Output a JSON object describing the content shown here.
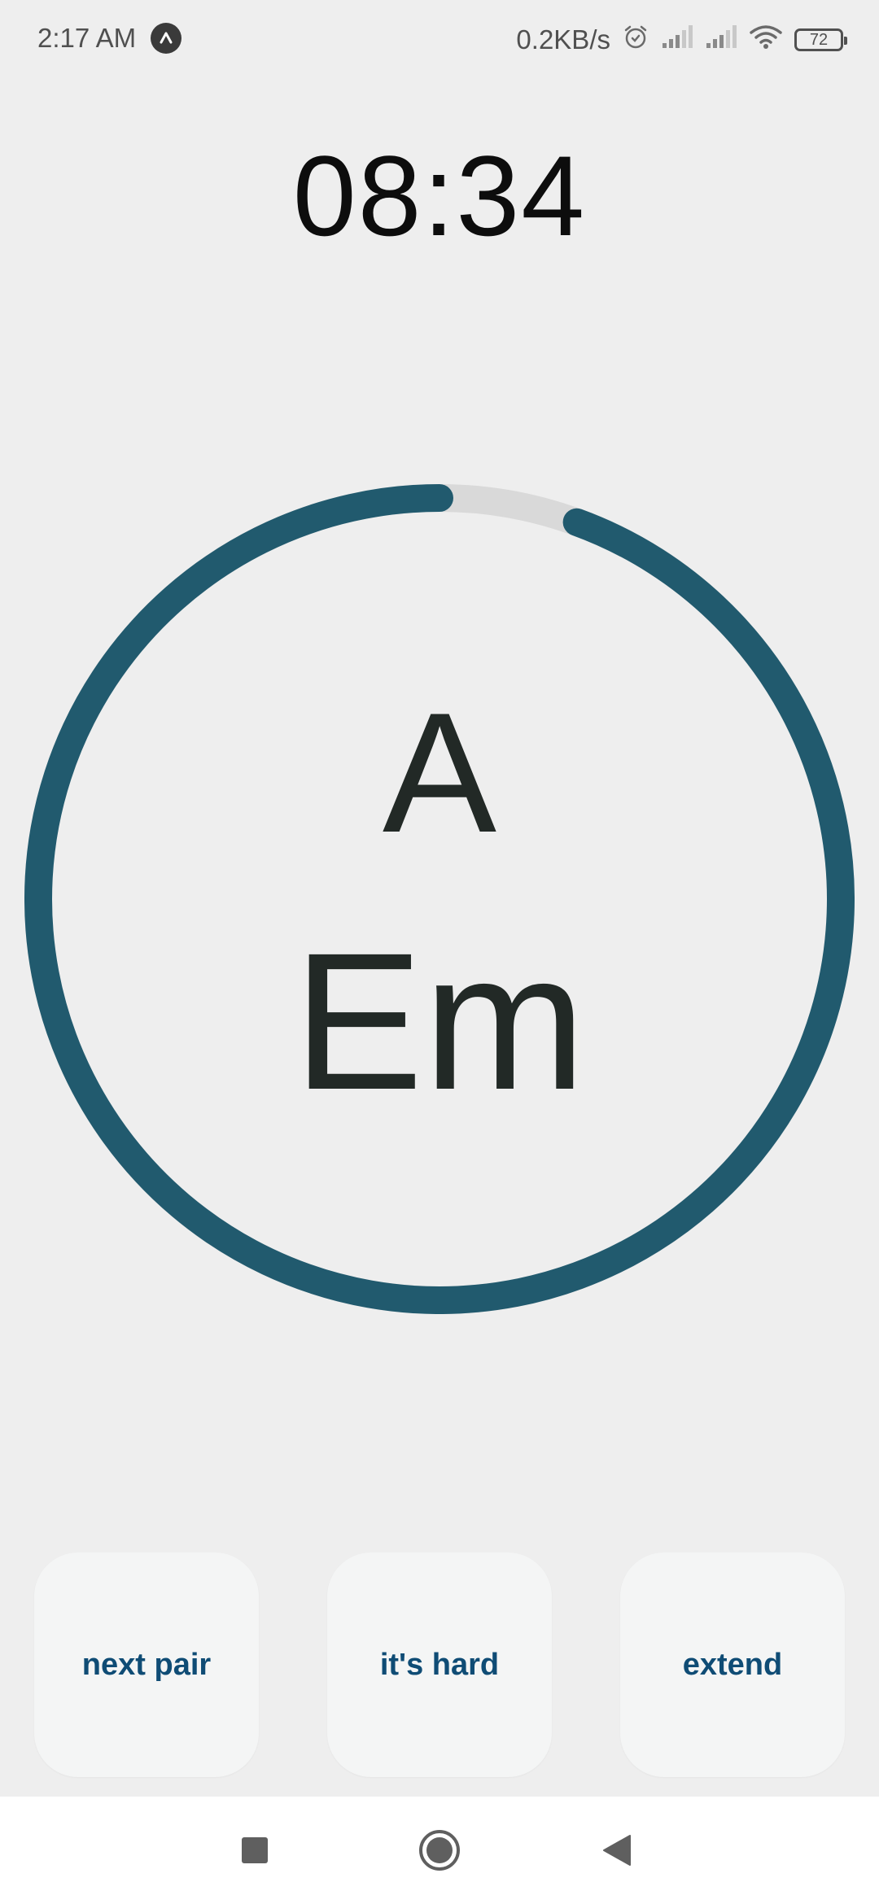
{
  "status_bar": {
    "time": "2:17 AM",
    "net_speed": "0.2KB/s",
    "battery_level": "72",
    "icons": [
      "app-badge-icon",
      "alarm-icon",
      "signal-icon",
      "signal-icon",
      "wifi-icon",
      "battery-icon"
    ]
  },
  "timer": {
    "value": "08:34"
  },
  "chords": {
    "current": "A",
    "next": "Em",
    "progress_fraction": 0.955
  },
  "actions": {
    "next_pair": "next pair",
    "hard": "it's hard",
    "extend": "extend"
  },
  "nav": {
    "icons": [
      "recent-apps-icon",
      "home-icon",
      "back-icon"
    ]
  },
  "colors": {
    "ring": "#215a6e",
    "ring_track": "#d9d9d9",
    "button_text": "#0f4c75",
    "background": "#eeeeee"
  }
}
